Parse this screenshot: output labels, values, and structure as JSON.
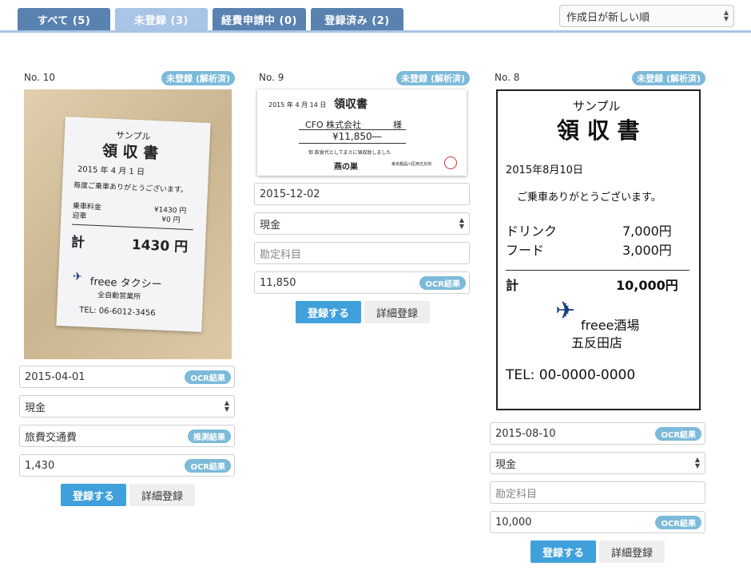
{
  "tabs": [
    {
      "label": "すべて (5)"
    },
    {
      "label": "未登録 (3)"
    },
    {
      "label": "経費申請中 (0)"
    },
    {
      "label": "登録済み (2)"
    }
  ],
  "sort": {
    "selected": "作成日が新しい順"
  },
  "cards": [
    {
      "no": "No. 10",
      "badge": "未登録 (解析済)",
      "date": {
        "value": "2015-04-01",
        "tag": "OCR結果"
      },
      "payment": {
        "value": "現金"
      },
      "account": {
        "value": "旅費交通費",
        "tag": "推測結果"
      },
      "amount": {
        "value": "1,430",
        "tag": "OCR結果"
      },
      "register_label": "登録する",
      "detail_label": "詳細登録",
      "receipt": {
        "lines": [
          "サンプル",
          "領 収 書",
          "2015 年 4 月 1 日",
          "毎度ご乗車ありがとうございます。",
          "乗車料金",
          "¥1430 円",
          "迎車",
          "¥0 円",
          "計",
          "1430 円",
          "freee タクシー",
          "全自動営業所",
          "TEL: 06-6012-3456"
        ]
      }
    },
    {
      "no": "No. 9",
      "badge": "未登録 (解析済)",
      "date": {
        "value": "2015-12-02"
      },
      "payment": {
        "value": "現金"
      },
      "account": {
        "placeholder": "勘定科目"
      },
      "amount": {
        "value": "11,850",
        "tag": "OCR結果"
      },
      "register_label": "登録する",
      "detail_label": "詳細登録",
      "receipt": {
        "lines": [
          "2015 年 4 月 14 日",
          "領収書",
          "CFO 株式会社",
          "様",
          "¥11,850―",
          "但 飲食代としてまさに領収致しました",
          "燕の巣",
          "東京都品川区西五反田"
        ]
      }
    },
    {
      "no": "No. 8",
      "badge": "未登録 (解析済)",
      "date": {
        "value": "2015-08-10",
        "tag": "OCR結果"
      },
      "payment": {
        "value": "現金"
      },
      "account": {
        "placeholder": "勘定科目"
      },
      "amount": {
        "value": "10,000",
        "tag": "OCR結果"
      },
      "register_label": "登録する",
      "detail_label": "詳細登録",
      "receipt": {
        "lines": [
          "サンプル",
          "領 収 書",
          "2015年8月10日",
          "ご乗車ありがとうございます。",
          "ドリンク",
          "7,000円",
          "フード",
          "3,000円",
          "計",
          "10,000円",
          "freee酒場",
          "五反田店",
          "TEL: 00-0000-0000"
        ]
      }
    }
  ]
}
